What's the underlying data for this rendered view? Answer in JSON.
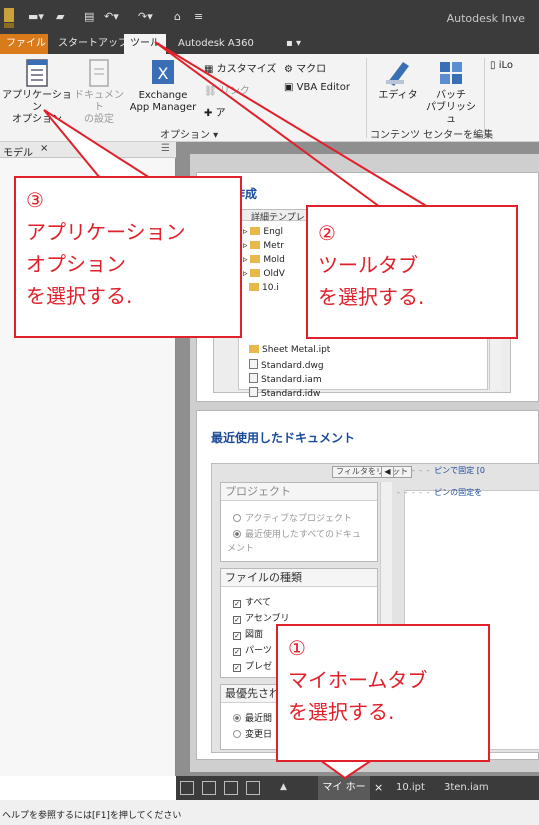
{
  "window": {
    "title": "Autodesk Inve"
  },
  "tabs": {
    "file": "ファイル",
    "startup": "スタートアップ",
    "tools": "ツール",
    "a360": "Autodesk A360",
    "extra": "▪ ▾"
  },
  "ribbon": {
    "app_options": [
      "アプリケーション",
      "オプション"
    ],
    "doc_settings": [
      "ドキュメント",
      "の設定"
    ],
    "exchange": [
      "Exchange",
      "App Manager"
    ],
    "customize": "カスタマイズ",
    "link": "リンク",
    "addin": "ア",
    "macro": "マクロ",
    "vba_editor": "VBA Editor",
    "group_options": "オプション ▾",
    "editor": "エディタ",
    "batch_publish": [
      "バッチ",
      "パブリッシュ"
    ],
    "group_content": "コンテンツ センターを編集",
    "ilogic": "iLo"
  },
  "model_panel": {
    "title": "モデル",
    "close": "×",
    "menu": "☰"
  },
  "new_section": {
    "title": "作成",
    "template_label": "詳細テンプレ",
    "folders": [
      "Engl",
      "Metr",
      "Mold",
      "OldV"
    ],
    "file_10": "10.i",
    "files": [
      "Sheet Metal.ipt",
      "Standard.dwg",
      "Standard.iam",
      "Standard.idw"
    ]
  },
  "recent_section": {
    "title": "最近使用したドキュメント",
    "filter_reset": "フィルタをリセット",
    "collapse": "◀",
    "project_title": "プロジェクト",
    "project_active": "アクティブなプロジェクト",
    "project_all": "最近使用したすべてのドキュ",
    "project_all_2": "メント",
    "filetype_title": "ファイルの種類",
    "filetypes": [
      "すべて",
      "アセンブリ",
      "図面",
      "パーツ",
      "プレゼ"
    ],
    "priority_title": "最優先され",
    "priority_items": [
      "最近間",
      "変更日"
    ],
    "pin_fixed": "ピンで固定 [0",
    "pin_unfixed": "ピンの固定を"
  },
  "doc_tabs": {
    "arrow": "▲",
    "home": "マイ ホーム",
    "home_close": "×",
    "tab_ipt": "10.ipt",
    "tab_iam": "3ten.iam"
  },
  "status": {
    "text": "ヘルプを参照するには[F1]を押してください"
  },
  "callouts": {
    "c1": [
      "①",
      "マイホームタブ",
      "を選択する."
    ],
    "c2": [
      "②",
      "ツールタブ",
      "を選択する."
    ],
    "c3": [
      "③",
      "アプリケーション",
      "オプション",
      "を選択する."
    ]
  },
  "colors": {
    "callout_red": "#e0202a",
    "file_tab_orange": "#d97b1a",
    "heading_blue": "#1a4a9a"
  }
}
